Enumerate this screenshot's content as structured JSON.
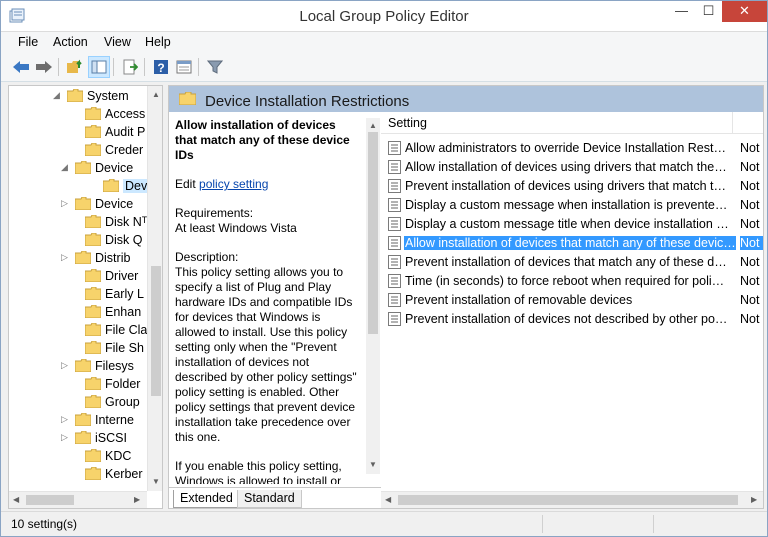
{
  "window": {
    "title": "Local Group Policy Editor",
    "controls": {
      "minimize": "—",
      "maximize": "☐",
      "close": "✕"
    }
  },
  "menu": [
    "File",
    "Action",
    "View",
    "Help"
  ],
  "toolbar": {
    "icons": [
      "back-arrow-icon",
      "forward-arrow-icon",
      "up-folder-icon",
      "show-hide-tree-icon",
      "export-list-icon",
      "help-icon",
      "properties-icon",
      "filter-icon"
    ]
  },
  "tree": {
    "items": [
      {
        "label": "System",
        "expander": "◢",
        "selected": false
      },
      {
        "label": "Access",
        "expander": "",
        "selected": false
      },
      {
        "label": "Audit P",
        "expander": "",
        "selected": false
      },
      {
        "label": "Creder",
        "expander": "",
        "selected": false
      },
      {
        "label": "Device",
        "expander": "◢",
        "selected": false
      },
      {
        "label": "Dev",
        "expander": "",
        "selected": true
      },
      {
        "label": "Device",
        "expander": "▷",
        "selected": false
      },
      {
        "label": "Disk Nᵀ",
        "expander": "",
        "selected": false
      },
      {
        "label": "Disk Q",
        "expander": "",
        "selected": false
      },
      {
        "label": "Distrib",
        "expander": "▷",
        "selected": false
      },
      {
        "label": "Driver",
        "expander": "",
        "selected": false
      },
      {
        "label": "Early L",
        "expander": "",
        "selected": false
      },
      {
        "label": "Enhan",
        "expander": "",
        "selected": false
      },
      {
        "label": "File Cla",
        "expander": "",
        "selected": false
      },
      {
        "label": "File Sh",
        "expander": "",
        "selected": false
      },
      {
        "label": "Filesys",
        "expander": "▷",
        "selected": false
      },
      {
        "label": "Folder",
        "expander": "",
        "selected": false
      },
      {
        "label": "Group",
        "expander": "",
        "selected": false
      },
      {
        "label": "Interne",
        "expander": "▷",
        "selected": false
      },
      {
        "label": "iSCSI",
        "expander": "▷",
        "selected": false
      },
      {
        "label": "KDC",
        "expander": "",
        "selected": false
      },
      {
        "label": "Kerber",
        "expander": "",
        "selected": false
      }
    ]
  },
  "header": {
    "title": "Device Installation Restrictions"
  },
  "description": {
    "title": "Allow installation of devices that match any of these device IDs",
    "edit_prefix": "Edit ",
    "edit_link": "policy setting",
    "requirements_label": "Requirements:",
    "requirements_value": "At least Windows Vista",
    "description_label": "Description:",
    "description_body": "This policy setting allows you to specify a list of Plug and Play hardware IDs and compatible IDs for devices that Windows is allowed to install. Use this policy setting only when the \"Prevent installation of devices not described by other policy settings\" policy setting is enabled. Other policy settings that prevent device installation take precedence over this one.",
    "description_more": "If you enable this policy setting, Windows is allowed to install or update any device whose Plug"
  },
  "tabs": {
    "extended": "Extended",
    "standard": "Standard"
  },
  "settings": {
    "column_setting": "Setting",
    "rows": [
      {
        "name": "Allow administrators to override Device Installation Restrictions policies",
        "state": "Not configured",
        "selected": false
      },
      {
        "name": "Allow installation of devices using drivers that match these device setup classes",
        "state": "Not configured",
        "selected": false
      },
      {
        "name": "Prevent installation of devices using drivers that match these device setup classes",
        "state": "Not configured",
        "selected": false
      },
      {
        "name": "Display a custom message when installation is prevented by a policy setting",
        "state": "Not configured",
        "selected": false
      },
      {
        "name": "Display a custom message title when device installation is prevented by a policy setting",
        "state": "Not configured",
        "selected": false
      },
      {
        "name": "Allow installation of devices that match any of these device IDs",
        "state": "Not configured",
        "selected": true
      },
      {
        "name": "Prevent installation of devices that match any of these device IDs",
        "state": "Not configured",
        "selected": false
      },
      {
        "name": "Time (in seconds) to force reboot when required for policy changes to take effect",
        "state": "Not configured",
        "selected": false
      },
      {
        "name": "Prevent installation of removable devices",
        "state": "Not configured",
        "selected": false
      },
      {
        "name": "Prevent installation of devices not described by other policy settings",
        "state": "Not configured",
        "selected": false
      }
    ]
  },
  "status": {
    "text": "10 setting(s)"
  },
  "colors": {
    "selection": "#3399ff",
    "header_band": "#aec3dc",
    "close_button": "#c7453a",
    "folder": "#f7d36b"
  }
}
